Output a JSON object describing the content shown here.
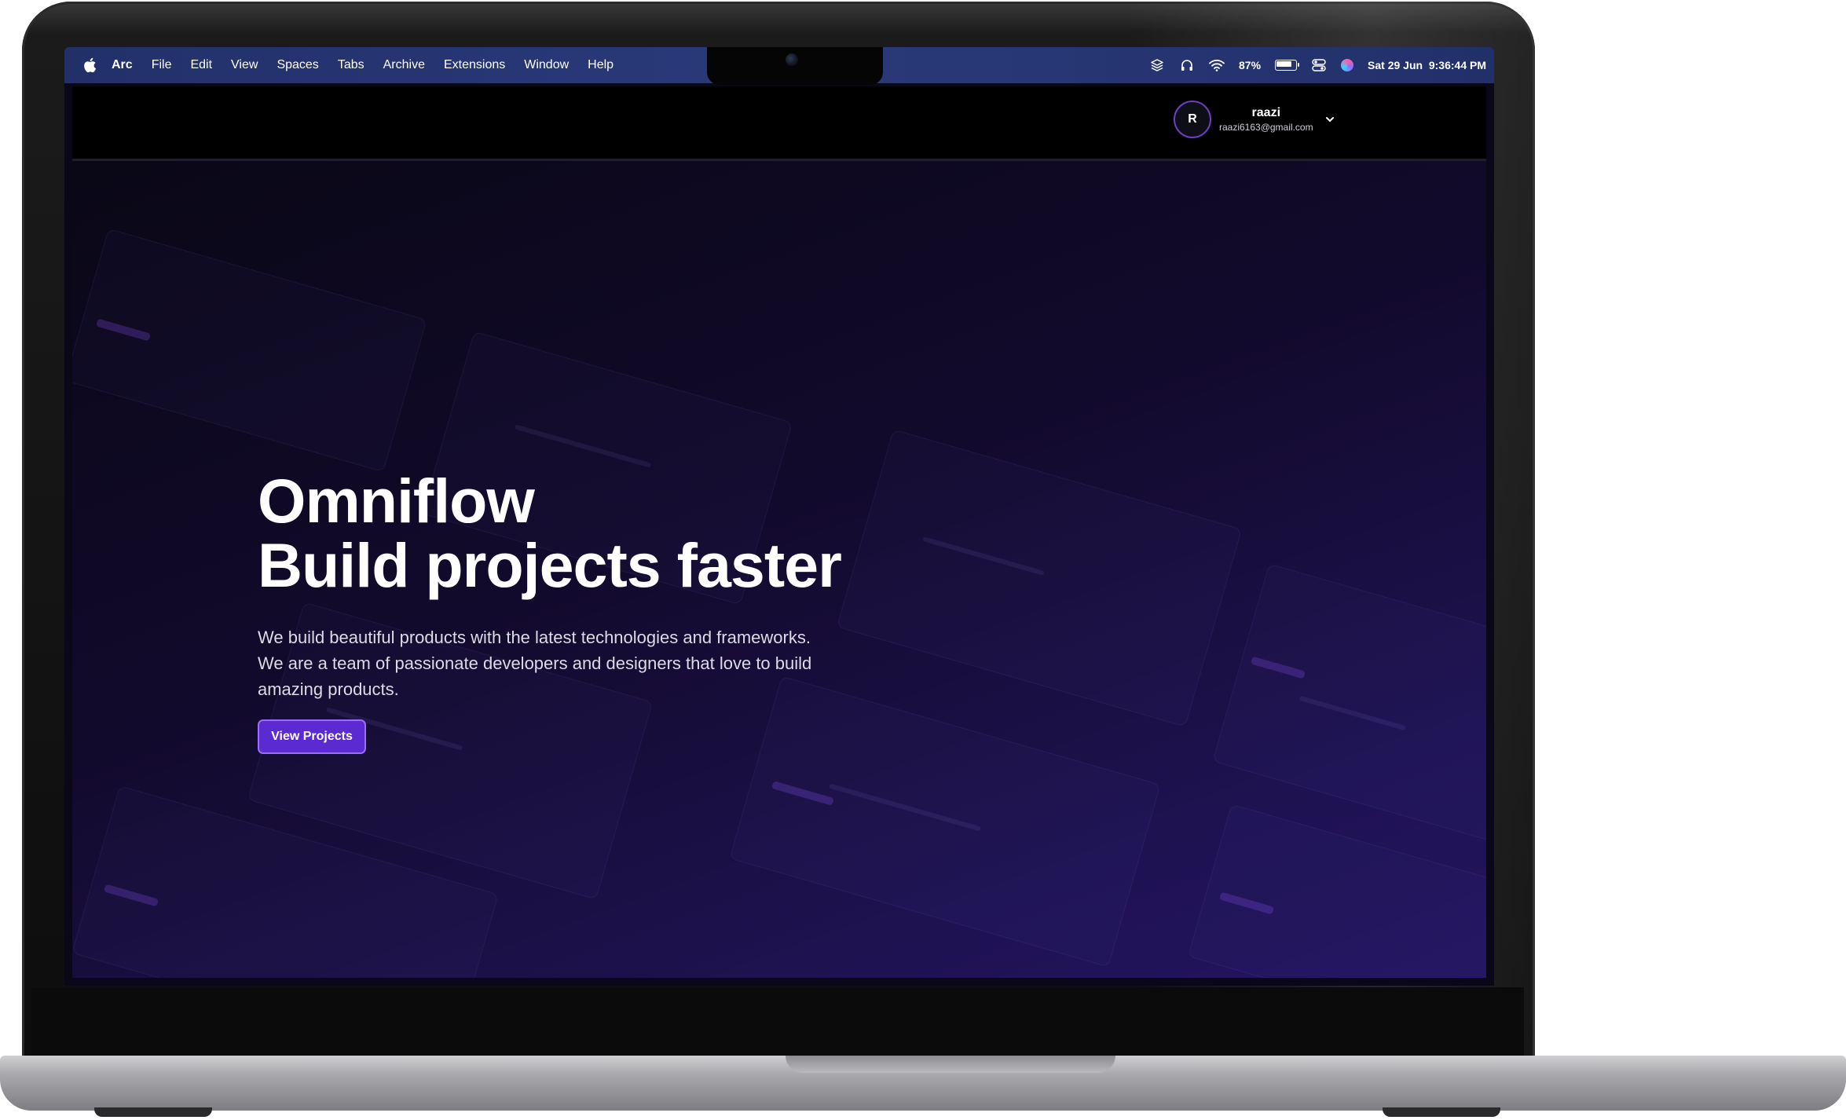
{
  "menubar": {
    "app_name": "Arc",
    "items": [
      "File",
      "Edit",
      "View",
      "Spaces",
      "Tabs",
      "Archive",
      "Extensions",
      "Window",
      "Help"
    ],
    "battery_percent": "87%",
    "datetime": "Sat 29 Jun  9:36:44 PM"
  },
  "user": {
    "initial": "R",
    "name": "raazi",
    "email": "raazi6163@gmail.com"
  },
  "hero": {
    "title_line1": "Omniflow",
    "title_line2": "Build projects faster",
    "description": "We build beautiful products with the latest technologies and frameworks. We are a team of passionate developers and designers that love to build amazing products.",
    "cta_label": "View Projects"
  },
  "colors": {
    "menubar": "#2a3a7a",
    "header": "#000000",
    "hero_start": "#0a0716",
    "hero_end": "#241460",
    "accent": "#5b2ad0",
    "accent_border": "#9a6cff"
  },
  "icons": [
    "apple-icon",
    "layers-icon",
    "headphones-icon",
    "wifi-icon",
    "battery-icon",
    "control-center-icon",
    "siri-icon",
    "chevron-down-icon"
  ]
}
